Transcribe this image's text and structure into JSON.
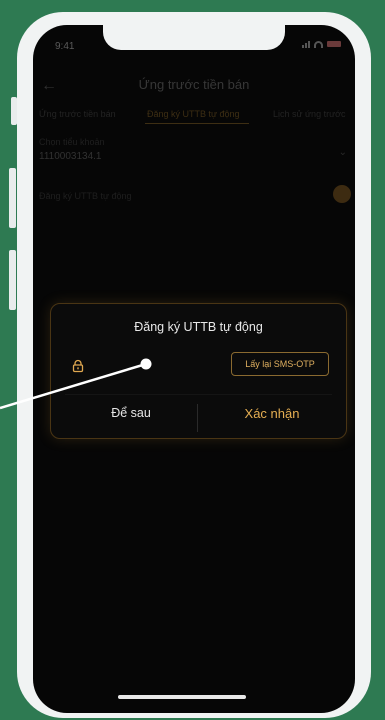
{
  "status_bar": {
    "time": "9:41"
  },
  "header": {
    "title": "Ứng trước tiền bán",
    "back_icon": "arrow-left-icon"
  },
  "tabs": [
    {
      "label": "Ứng trước tiền bán",
      "active": false
    },
    {
      "label": "Đăng ký UTTB tự động",
      "active": true
    },
    {
      "label": "Lịch sử ứng trước",
      "active": false
    }
  ],
  "account": {
    "label": "Chọn tiểu khoản",
    "value": "1110003134.1"
  },
  "auto_setting": {
    "label": "Đăng ký UTTB tự động"
  },
  "modal": {
    "title": "Đăng ký UTTB tự động",
    "otp_button": "Lấy lại SMS-OTP",
    "cancel_button": "Để sau",
    "confirm_button": "Xác nhận"
  },
  "colors": {
    "background": "#2e7a52",
    "accent": "#e5ae52",
    "screen": "#060606"
  }
}
